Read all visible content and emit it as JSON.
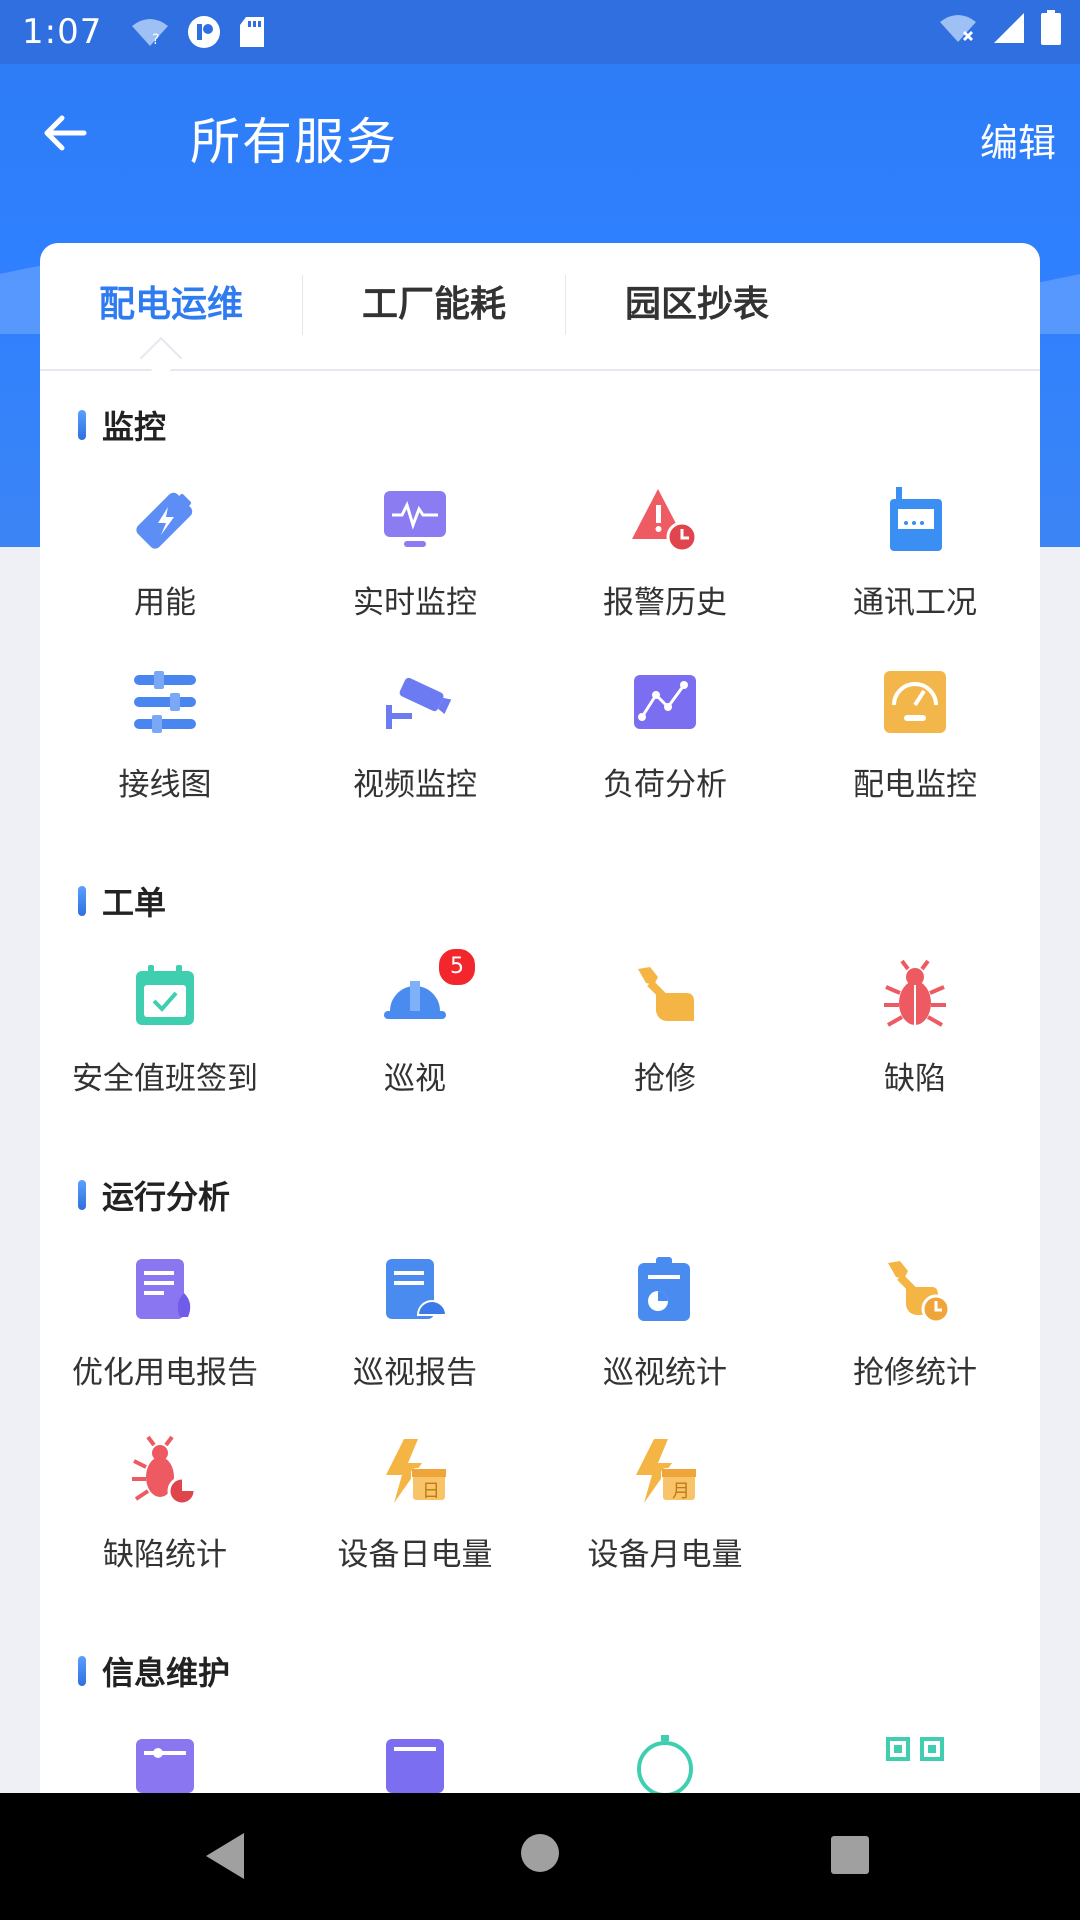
{
  "status_bar": {
    "time": "1:07"
  },
  "header": {
    "title": "所有服务",
    "edit_label": "编辑"
  },
  "colors": {
    "accent": "#2f7bf0",
    "header_bg": "#2f80ff",
    "badge": "#f2262b"
  },
  "tabs": [
    {
      "label": "配电运维",
      "active": true
    },
    {
      "label": "工厂能耗",
      "active": false
    },
    {
      "label": "园区抄表",
      "active": false
    }
  ],
  "sections": {
    "monitor": {
      "title": "监控",
      "items": [
        {
          "label": "用能",
          "icon": "battery-bolt-icon"
        },
        {
          "label": "实时监控",
          "icon": "monitor-pulse-icon"
        },
        {
          "label": "报警历史",
          "icon": "alarm-clock-icon"
        },
        {
          "label": "通讯工况",
          "icon": "communication-device-icon"
        },
        {
          "label": "接线图",
          "icon": "wiring-diagram-icon"
        },
        {
          "label": "视频监控",
          "icon": "camera-icon"
        },
        {
          "label": "负荷分析",
          "icon": "load-chart-icon"
        },
        {
          "label": "配电监控",
          "icon": "gauge-panel-icon"
        }
      ]
    },
    "workorder": {
      "title": "工单",
      "items": [
        {
          "label": "安全值班签到",
          "icon": "calendar-check-icon"
        },
        {
          "label": "巡视",
          "icon": "helmet-icon",
          "badge": "5"
        },
        {
          "label": "抢修",
          "icon": "wrench-hand-icon"
        },
        {
          "label": "缺陷",
          "icon": "bug-icon"
        }
      ]
    },
    "analysis": {
      "title": "运行分析",
      "items": [
        {
          "label": "优化用电报告",
          "icon": "report-rocket-icon"
        },
        {
          "label": "巡视报告",
          "icon": "report-helmet-icon"
        },
        {
          "label": "巡视统计",
          "icon": "clipboard-pie-icon"
        },
        {
          "label": "抢修统计",
          "icon": "wrench-clock-icon"
        },
        {
          "label": "缺陷统计",
          "icon": "bug-pie-icon"
        },
        {
          "label": "设备日电量",
          "icon": "bolt-day-icon",
          "glyph": "日"
        },
        {
          "label": "设备月电量",
          "icon": "bolt-month-icon",
          "glyph": "月"
        }
      ]
    },
    "info": {
      "title": "信息维护",
      "items": [
        {
          "icon": "settings-card-icon"
        },
        {
          "icon": "screen-icon"
        },
        {
          "icon": "timer-icon"
        },
        {
          "icon": "qr-code-icon"
        }
      ]
    }
  }
}
